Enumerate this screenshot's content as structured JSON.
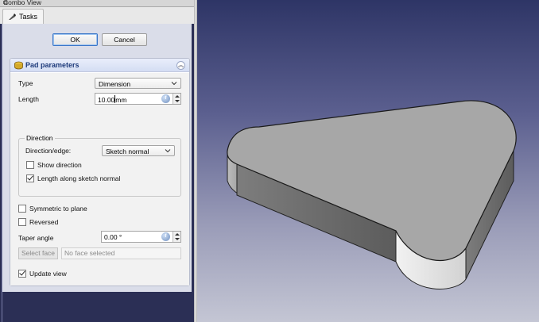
{
  "combo_view": {
    "title": "Combo View",
    "float_icon": "undock-icon"
  },
  "tabs": [
    {
      "label": "Tasks",
      "icon": "tasks-icon"
    }
  ],
  "dialog": {
    "ok_label": "OK",
    "cancel_label": "Cancel"
  },
  "pad": {
    "title": "Pad parameters",
    "icon": "pad-icon",
    "type_label": "Type",
    "type_value": "Dimension",
    "length_label": "Length",
    "length_value": "10.00",
    "length_unit": "mm",
    "direction": {
      "group_title": "Direction",
      "edge_label": "Direction/edge:",
      "edge_value": "Sketch normal",
      "show_direction_label": "Show direction",
      "show_direction_checked": false,
      "along_normal_label": "Length along sketch normal",
      "along_normal_checked": true
    },
    "symmetric_label": "Symmetric to plane",
    "symmetric_checked": false,
    "reversed_label": "Reversed",
    "reversed_checked": false,
    "taper_label": "Taper angle",
    "taper_value": "0.00 °",
    "select_face_label": "Select face",
    "face_placeholder": "No face selected",
    "update_view_label": "Update view",
    "update_view_checked": true
  },
  "colors": {
    "panel_bg": "#2b2f55",
    "task_bg": "#dadde9",
    "group_head": "#d4ddf3",
    "accent": "#3a76c8",
    "solid_top": "#a7a7a7"
  }
}
